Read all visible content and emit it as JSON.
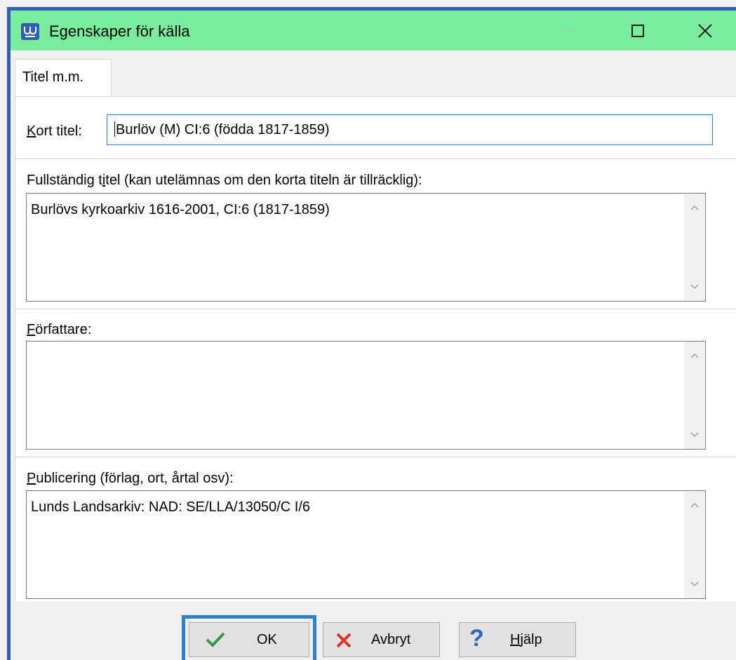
{
  "window": {
    "title": "Egenskaper för källa"
  },
  "tabs": [
    {
      "label": "Titel m.m."
    }
  ],
  "form": {
    "short_title": {
      "label": "Kort titel:",
      "value": "Burlöv (M) CI:6 (födda 1817-1859)"
    },
    "full_title": {
      "label": "Fullständig titel (kan utelämnas om den korta titeln är tillräcklig):",
      "value": "Burlövs kyrkoarkiv 1616-2001, CI:6 (1817-1859)"
    },
    "author": {
      "label": "Författare:",
      "value": ""
    },
    "publishing": {
      "label": "Publicering (förlag, ort, årtal osv):",
      "value": "Lunds Landsarkiv: NAD: SE/LLA/13050/C I/6"
    }
  },
  "buttons": {
    "ok": "OK",
    "cancel": "Avbryt",
    "help": "Hjälp"
  },
  "colors": {
    "titlebar": "#7bec9b",
    "accent": "#2d7fd6",
    "window_border": "#2d5fb7",
    "ok_check": "#2e9a4a",
    "cancel_x": "#d9342b",
    "help_q": "#2d68c4"
  },
  "icons": {
    "app": "app-icon",
    "minimize": "minimize-icon",
    "maximize": "maximize-icon",
    "close": "close-icon",
    "ok": "checkmark-icon",
    "cancel": "x-icon",
    "help": "question-mark-icon"
  }
}
